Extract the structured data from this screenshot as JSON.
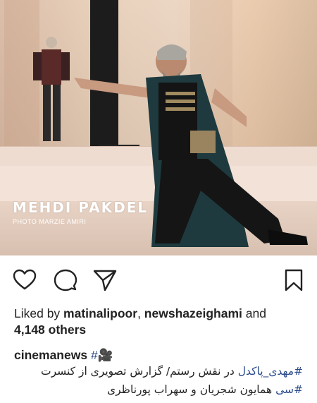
{
  "post": {
    "photo_watermark": "MEHDI PAKDEL",
    "photo_credit": "PHOTO MARZIE AMIRI"
  },
  "actions": {
    "like_icon": "heart-icon",
    "comment_icon": "comment-icon",
    "share_icon": "share-icon",
    "save_icon": "bookmark-icon"
  },
  "likes": {
    "prefix": "Liked by ",
    "user1": "matinalipoor",
    "separator": ", ",
    "user2": "newshazeighami",
    "and": " and",
    "others": "4,148 others"
  },
  "caption": {
    "username": "cinemanews",
    "hashtag": "#🎥",
    "line1_tag": "#مهدی_پاکدل",
    "line1_text": " در نقش رستم/ گزارش تصویری از کنسرت",
    "line2_tag": "#سی",
    "line2_text": " همایون شجریان و سهراب پورناظری"
  },
  "colors": {
    "hashtag": "#2a4a8a",
    "text": "#222222"
  }
}
